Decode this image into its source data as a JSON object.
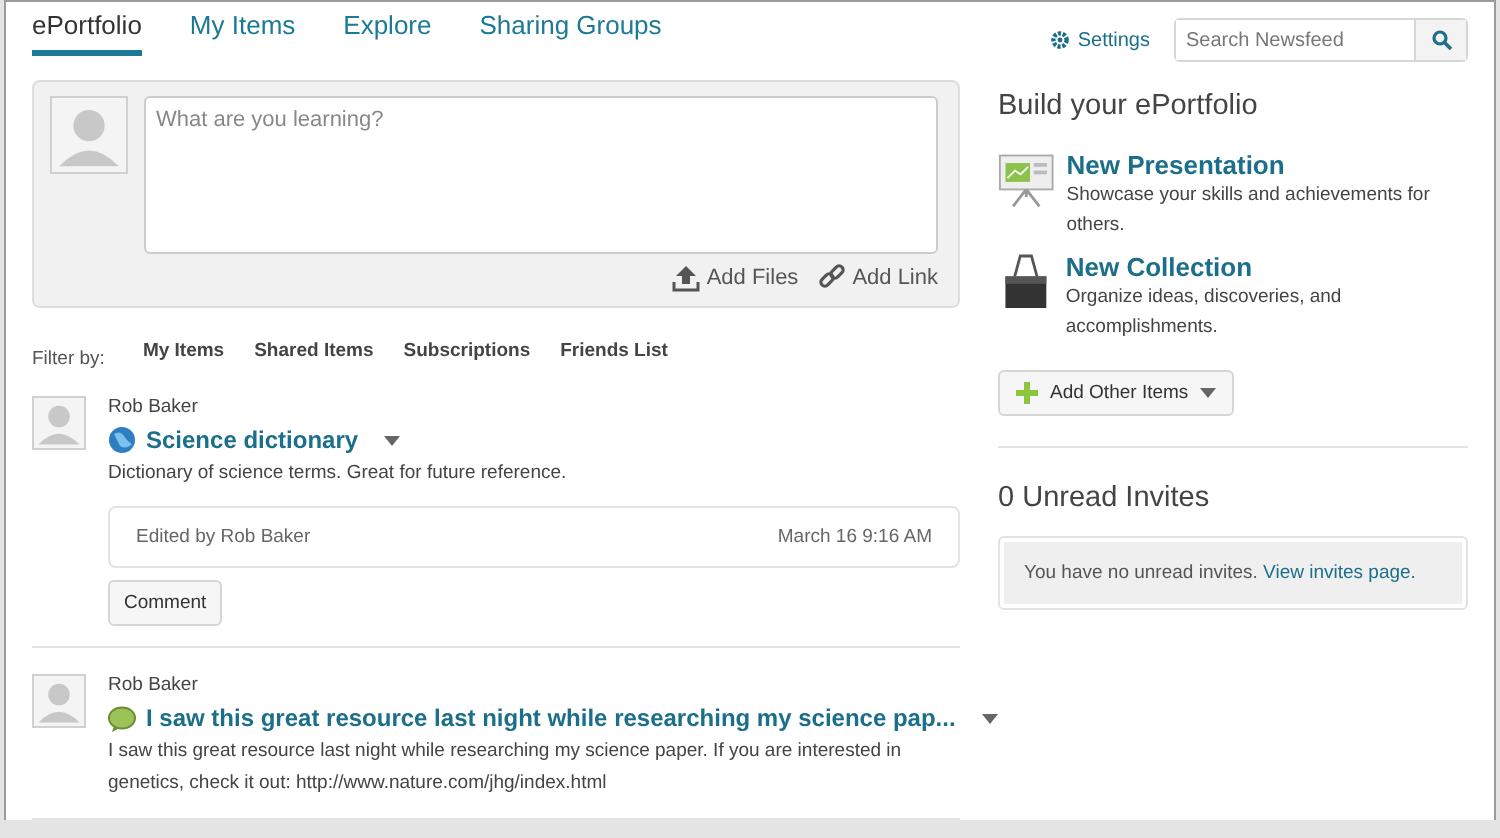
{
  "tabs": [
    {
      "label": "ePortfolio",
      "selected": true
    },
    {
      "label": "My Items",
      "selected": false
    },
    {
      "label": "Explore",
      "selected": false
    },
    {
      "label": "Sharing Groups",
      "selected": false
    }
  ],
  "settings": "Settings",
  "search": {
    "placeholder": "Search Newsfeed"
  },
  "composer": {
    "placeholder": "What are you learning?",
    "actions": [
      {
        "kind": "upload",
        "label": "Add Files"
      },
      {
        "kind": "link",
        "label": "Add Link"
      }
    ]
  },
  "filter": {
    "label": "Filter by:",
    "options": [
      "My Items",
      "Shared Items",
      "Subscriptions",
      "Friends List"
    ]
  },
  "posts": [
    {
      "author": "Rob Baker",
      "kind": "web",
      "title": "Science dictionary",
      "body": "Dictionary of science terms. Great for future reference.",
      "edited_by": "Edited by Rob Baker",
      "time": "March 16 9:16 AM",
      "button": "Comment"
    },
    {
      "author": "Rob Baker",
      "kind": "note",
      "title": "I saw this great resource last night while researching my science pap...",
      "body": "I saw this great resource last night while researching my science paper. If you are interested in genetics, check it out: http://www.nature.com/jhg/index.html"
    }
  ],
  "build": {
    "title": "Build your ePortfolio",
    "items": [
      {
        "kind": "presentation",
        "title": "New Presentation",
        "description": "Showcase your skills and achievements for others."
      },
      {
        "kind": "collection",
        "title": "New Collection",
        "description": "Organize ideas, discoveries, and accomplishments."
      }
    ],
    "add_button": "Add Other Items"
  },
  "invites": {
    "title": "0 Unread Invites",
    "message": "You have no unread invites.",
    "link": "View invites page."
  }
}
